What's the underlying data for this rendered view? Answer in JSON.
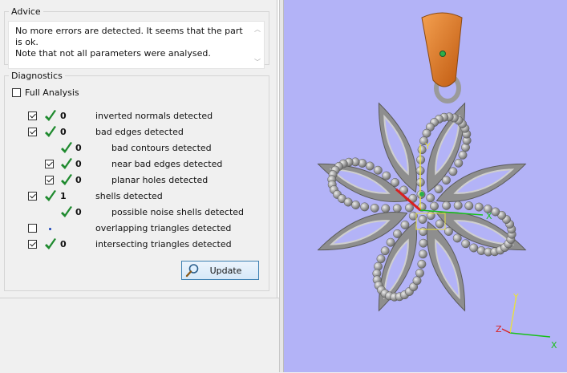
{
  "advice": {
    "title": "Advice",
    "text": "No more errors are detected. It seems that the part is ok.\nNote that not all parameters were analysed.",
    "scroll_up": "︿",
    "scroll_down": "﹀"
  },
  "diagnostics": {
    "title": "Diagnostics",
    "full_analysis": {
      "label": "Full Analysis",
      "checked": false
    },
    "rows": [
      {
        "count": "0",
        "label": "inverted normals detected",
        "checked": true,
        "has_checkbox": true,
        "ok": true
      },
      {
        "count": "0",
        "label": "bad edges detected",
        "checked": true,
        "has_checkbox": true,
        "ok": true
      },
      {
        "count": "0",
        "label": "bad contours detected",
        "checked": false,
        "has_checkbox": false,
        "ok": true
      },
      {
        "count": "0",
        "label": "near bad edges detected",
        "checked": true,
        "has_checkbox": true,
        "ok": true
      },
      {
        "count": "0",
        "label": "planar holes detected",
        "checked": true,
        "has_checkbox": true,
        "ok": true
      },
      {
        "count": "1",
        "label": "shells detected",
        "checked": true,
        "has_checkbox": true,
        "ok": true
      },
      {
        "count": "0",
        "label": "possible noise shells detected",
        "checked": false,
        "has_checkbox": false,
        "ok": true
      },
      {
        "count": "",
        "label": "overlapping triangles detected",
        "checked": false,
        "has_checkbox": true,
        "ok": false
      },
      {
        "count": "0",
        "label": "intersecting triangles detected",
        "checked": true,
        "has_checkbox": true,
        "ok": true
      }
    ],
    "update_label": "Update"
  },
  "viewport": {
    "background": "#b3b3f7",
    "axis_x": "X",
    "axis_y": "Y",
    "axis_z": "Z",
    "colors": {
      "model": "#a6a6a6",
      "bail": "#e0741c",
      "axis_x": "#18c018",
      "axis_y": "#e8e040",
      "axis_z": "#d82020"
    }
  },
  "colors": {
    "tick": "#1e8a2e",
    "button_border": "#3c7fb1"
  }
}
